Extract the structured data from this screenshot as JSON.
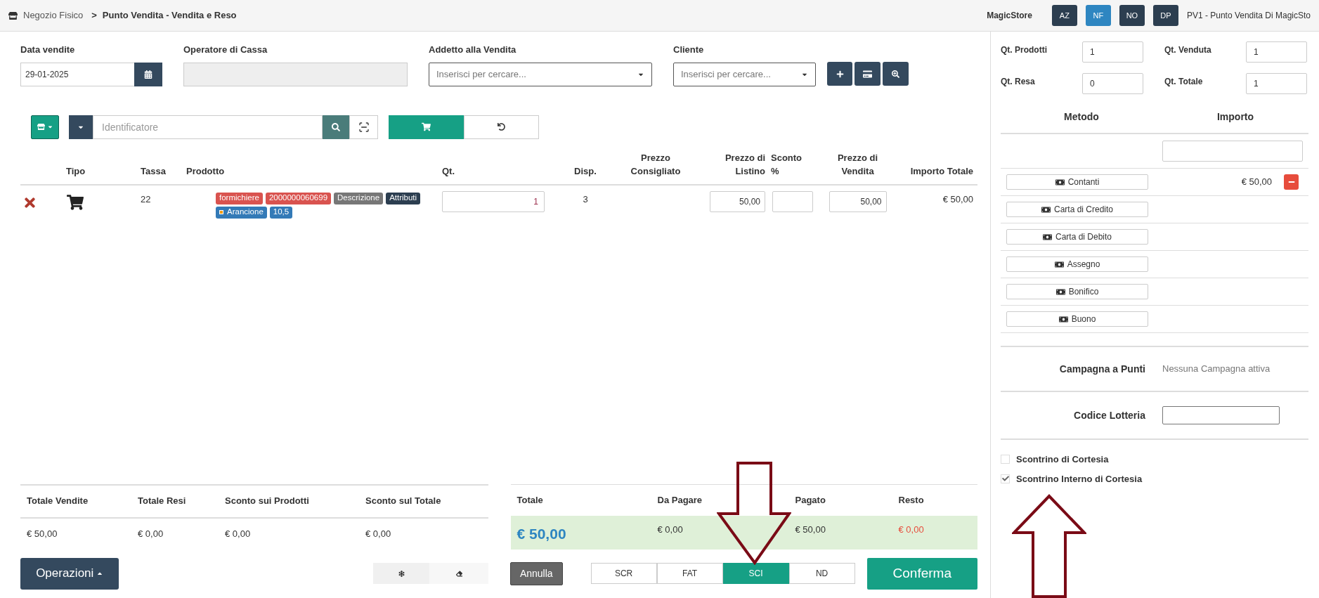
{
  "breadcrumb": {
    "home": "Negozio Fisico",
    "separator": ">",
    "current": "Punto Vendita - Vendita e Reso"
  },
  "header": {
    "store": "MagicStore",
    "shortcuts": [
      {
        "label": "AZ",
        "selected": false
      },
      {
        "label": "NF",
        "selected": true
      },
      {
        "label": "NO",
        "selected": false
      },
      {
        "label": "DP",
        "selected": false
      }
    ],
    "point_of_sale": "PV1 - Punto Vendita Di MagicSto"
  },
  "form": {
    "date": {
      "label": "Data vendite",
      "value": "29-01-2025"
    },
    "cashier": {
      "label": "Operatore di Cassa",
      "disabled": true
    },
    "clerk": {
      "label": "Addetto alla Vendita",
      "placeholder": "Inserisci per cercare..."
    },
    "customer": {
      "label": "Cliente",
      "placeholder": "Inserisci per cercare..."
    }
  },
  "search": {
    "placeholder": "Identificatore"
  },
  "mode_toggle": [
    {
      "kind": "cart",
      "selected": true
    },
    {
      "kind": "reset",
      "selected": false
    }
  ],
  "table": {
    "columns": [
      "Tipo",
      "Tassa",
      "Prodotto",
      "Qt.",
      "Disp.",
      "Prezzo Consigliato",
      "Prezzo di Listino",
      "Sconto %",
      "Prezzo di Vendita",
      "Importo Totale"
    ],
    "rows": [
      {
        "tax": "22",
        "tags": [
          {
            "text": "formichiere",
            "color": "#d9534f",
            "kind": "text"
          },
          {
            "text": "2000000060699",
            "color": "#d9534f",
            "kind": "text"
          },
          {
            "text": "Descrizione",
            "color": "#777777",
            "kind": "text"
          },
          {
            "text": "Attributi",
            "color": "#2c3e50",
            "kind": "text"
          },
          {
            "text": "Arancione",
            "color": "#337ab7",
            "kind": "swatch"
          },
          {
            "text": "10,5",
            "color": "#337ab7",
            "kind": "text"
          }
        ],
        "qty": "1",
        "available": "3",
        "list_price": "50,00",
        "sale_price": "50,00",
        "total": "€ 50,00"
      }
    ]
  },
  "summary": [
    {
      "label": "Totale Vendite",
      "value": "€ 50,00"
    },
    {
      "label": "Totale Resi",
      "value": "€ 0,00"
    },
    {
      "label": "Sconto sui Prodotti",
      "value": "€ 0,00"
    },
    {
      "label": "Sconto sul Totale",
      "value": "€ 0,00"
    }
  ],
  "payment_summary": [
    {
      "label": "Totale",
      "value": "€ 50,00",
      "kind": "total"
    },
    {
      "label": "Da Pagare",
      "value": "€ 0,00",
      "kind": "plain"
    },
    {
      "label": "Pagato",
      "value": "€ 50,00",
      "kind": "plain"
    },
    {
      "label": "Resto",
      "value": "€ 0,00",
      "kind": "alert"
    }
  ],
  "actions": {
    "operations": "Operazioni",
    "cancel": "Annulla",
    "document_types": [
      {
        "label": "SCR",
        "selected": false
      },
      {
        "label": "FAT",
        "selected": false
      },
      {
        "label": "SCI",
        "selected": true
      },
      {
        "label": "ND",
        "selected": false
      }
    ],
    "confirm": "Conferma"
  },
  "quantities": [
    {
      "label": "Qt. Prodotti",
      "value": "1"
    },
    {
      "label": "Qt. Venduta",
      "value": "1"
    },
    {
      "label": "Qt. Resa",
      "value": "0"
    },
    {
      "label": "Qt. Totale",
      "value": "1"
    }
  ],
  "payments": {
    "columns": [
      "Metodo",
      "Importo"
    ],
    "methods": [
      {
        "label": "Contanti",
        "amount": "€ 50,00"
      },
      {
        "label": "Carta di Credito"
      },
      {
        "label": "Carta di Debito"
      },
      {
        "label": "Assegno"
      },
      {
        "label": "Bonifico"
      },
      {
        "label": "Buono"
      }
    ]
  },
  "campaign": {
    "label": "Campagna a Punti",
    "value": "Nessuna Campagna attiva"
  },
  "lottery": {
    "label": "Codice Lotteria"
  },
  "receipts": [
    {
      "label": "Scontrino di Cortesia",
      "checked": false
    },
    {
      "label": "Scontrino Interno di Cortesia",
      "checked": true
    }
  ],
  "annotations": [
    {
      "kind": "down"
    },
    {
      "kind": "up"
    }
  ]
}
